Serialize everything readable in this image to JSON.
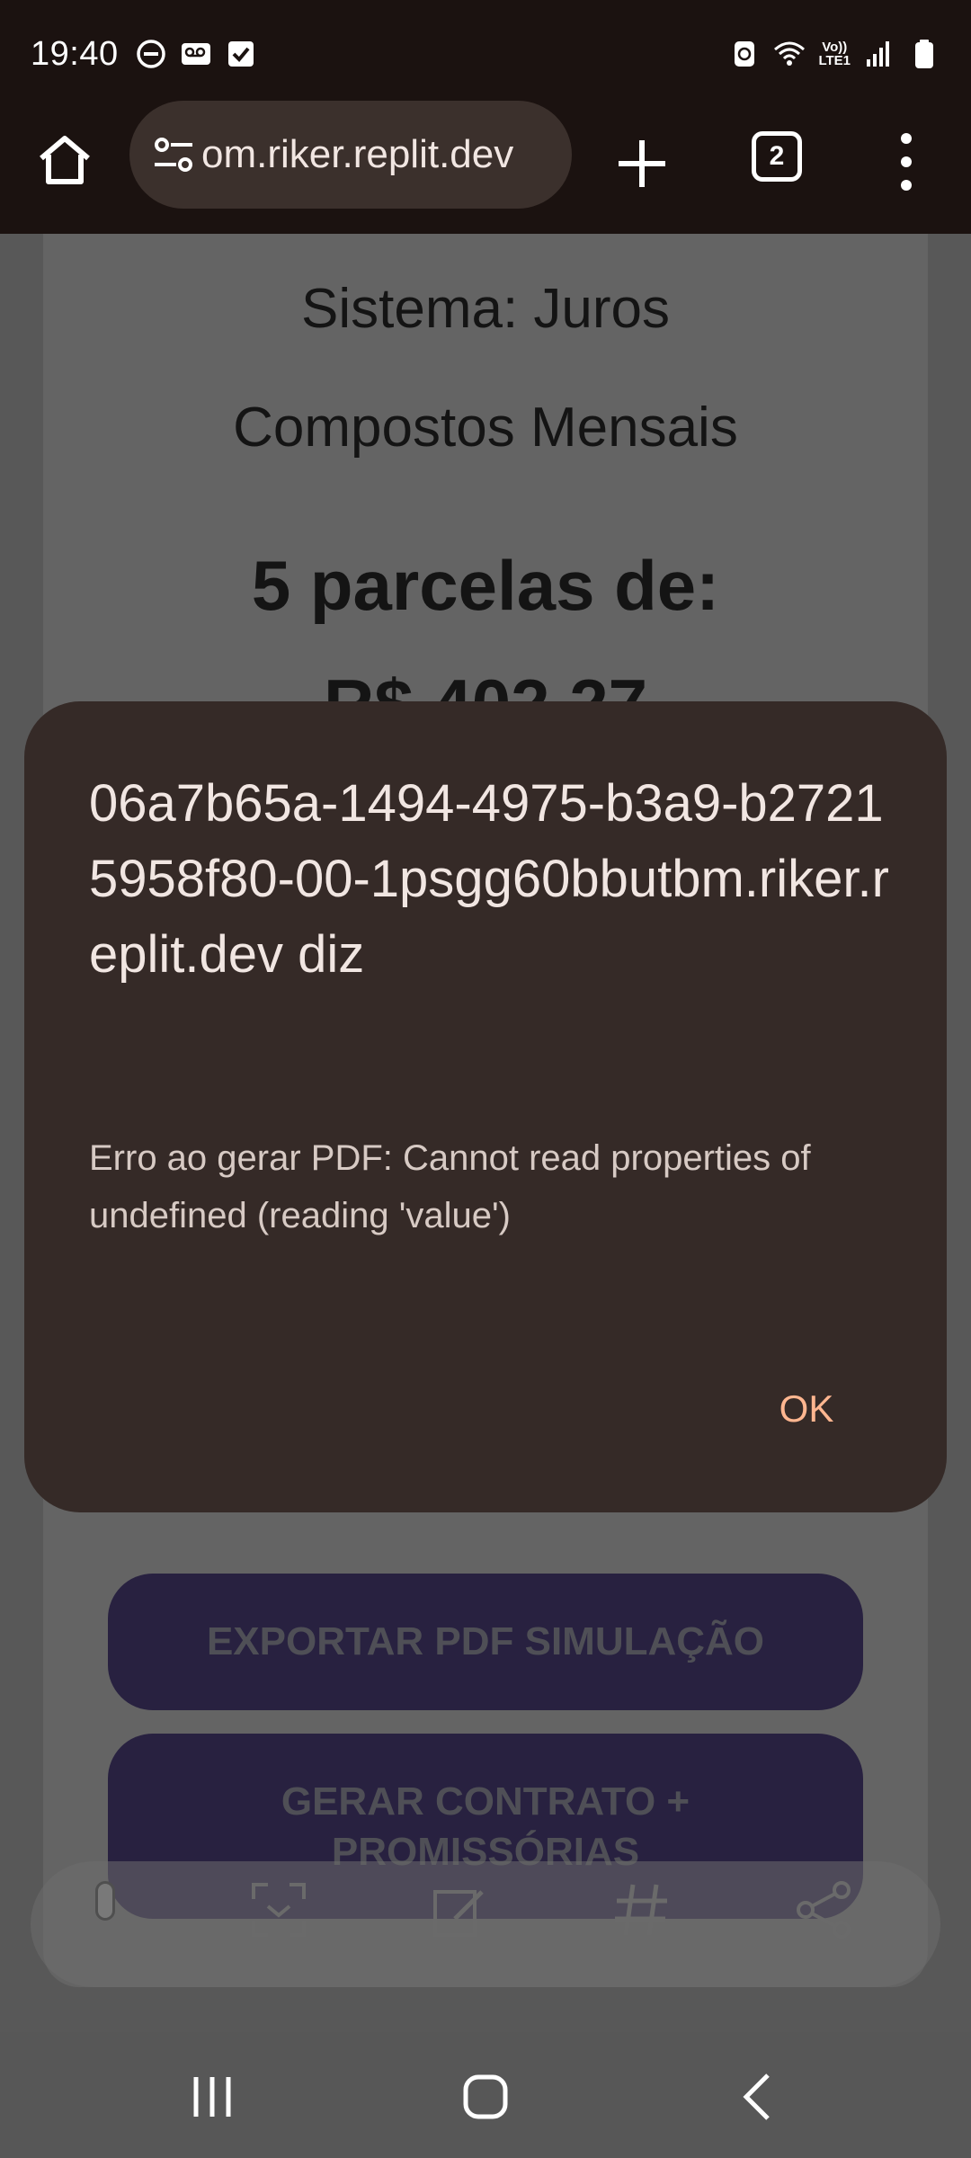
{
  "status_bar": {
    "time": "19:40",
    "left_icons": [
      "do-not-disturb-icon",
      "voicemail-icon",
      "checkbox-notification-icon"
    ],
    "right_icons": [
      "battery-saver-icon",
      "wifi-icon",
      "volte-lte-icon",
      "signal-icon",
      "battery-icon"
    ],
    "volte_label": "Vo))",
    "lte_label": "LTE1"
  },
  "browser": {
    "url_text": "om.riker.replit.dev",
    "tab_count": "2"
  },
  "page": {
    "title_line_1": "Sistema: Juros",
    "title_line_2": "Compostos Mensais",
    "installments_line": "5 parcelas de:",
    "amount_line": "R$ 402,27",
    "export_button": "EXPORTAR PDF SIMULAÇÃO",
    "contract_button_line_1": "GERAR CONTRATO +",
    "contract_button_line_2": "PROMISSÓRIAS"
  },
  "dialog": {
    "title": "06a7b65a-1494-4975-b3a9-b27215958f80-00-1psgg60bbutbm.riker.replit.dev diz",
    "message": "Erro ao gerar PDF: Cannot read properties of undefined (reading 'value')",
    "ok_label": "OK"
  },
  "colors": {
    "dialog_bg": "#352a27",
    "ok_accent": "#ffb690",
    "status_bg": "#1b1210"
  }
}
